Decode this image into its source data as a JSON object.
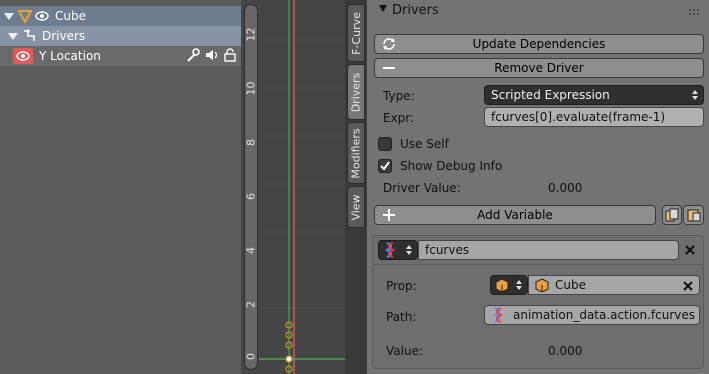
{
  "channels": {
    "object_name": "Cube",
    "drivers_label": "Drivers",
    "fcurve_label": "Y Location"
  },
  "graph": {
    "y_ticks": [
      "12",
      "10",
      "8",
      "6",
      "4",
      "2",
      "0"
    ]
  },
  "tabs": [
    "F-Curve",
    "Drivers",
    "Modifiers",
    "View"
  ],
  "panel": {
    "header": "Drivers",
    "update_deps_label": "Update Dependencies",
    "remove_driver_label": "Remove Driver",
    "type_label": "Type:",
    "type_value": "Scripted Expression",
    "expr_label": "Expr:",
    "expr_value": "fcurves[0].evaluate(frame-1)",
    "use_self_label": "Use Self",
    "show_debug_label": "Show Debug Info",
    "driver_value_label": "Driver Value:",
    "driver_value": "0.000",
    "add_variable_label": "Add Variable",
    "variable": {
      "name": "fcurves",
      "prop_label": "Prop:",
      "prop_value": "Cube",
      "path_label": "Path:",
      "path_value": "animation_data.action.fcurves",
      "value_label": "Value:",
      "value": "0.000"
    }
  },
  "colors": {
    "accent_selected": "#6d7c8e",
    "curve_red": "#e06060",
    "curve_green": "#3fbf3f",
    "keyframe_orange": "#c98a2a"
  }
}
